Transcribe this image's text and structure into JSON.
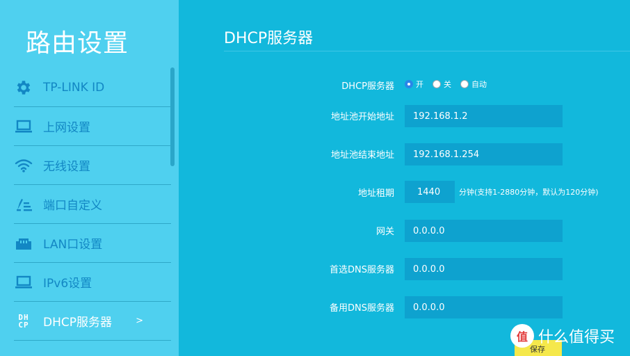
{
  "sidebar": {
    "title": "路由设置",
    "items": [
      {
        "label": "TP-LINK ID",
        "icon": "gear-icon"
      },
      {
        "label": "上网设置",
        "icon": "laptop-icon"
      },
      {
        "label": "无线设置",
        "icon": "wifi-icon"
      },
      {
        "label": "端口自定义",
        "icon": "edit-list-icon"
      },
      {
        "label": "LAN口设置",
        "icon": "ethernet-port-icon"
      },
      {
        "label": "IPv6设置",
        "icon": "laptop-icon"
      },
      {
        "label": "DHCP服务器",
        "icon": "dhcp-icon",
        "icon_text_top": "DH",
        "icon_text_bottom": "CP",
        "chevron": ">",
        "active": true
      }
    ]
  },
  "main": {
    "title": "DHCP服务器",
    "dhcp_server": {
      "label": "DHCP服务器",
      "options": [
        "开",
        "关",
        "自动"
      ],
      "selected": "开"
    },
    "pool_start": {
      "label": "地址池开始地址",
      "value": "192.168.1.2"
    },
    "pool_end": {
      "label": "地址池结束地址",
      "value": "192.168.1.254"
    },
    "lease": {
      "label": "地址租期",
      "value": "1440",
      "hint": "分钟(支持1-2880分钟，默认为120分钟)"
    },
    "gateway": {
      "label": "网关",
      "value": "0.0.0.0"
    },
    "primary_dns": {
      "label": "首选DNS服务器",
      "value": "0.0.0.0"
    },
    "secondary_dns": {
      "label": "备用DNS服务器",
      "value": "0.0.0.0"
    },
    "save_label": "保存"
  },
  "watermark": {
    "logo_glyph": "值",
    "text": "什么值得买"
  },
  "colors": {
    "main_bg": "#12b8dc",
    "sidebar_bg": "#4fd0ef",
    "sidebar_label": "#1287c4",
    "input_bg": "#0ea2cf",
    "radio_checked": "#2a86e8",
    "save_button": "#f5e84b"
  }
}
